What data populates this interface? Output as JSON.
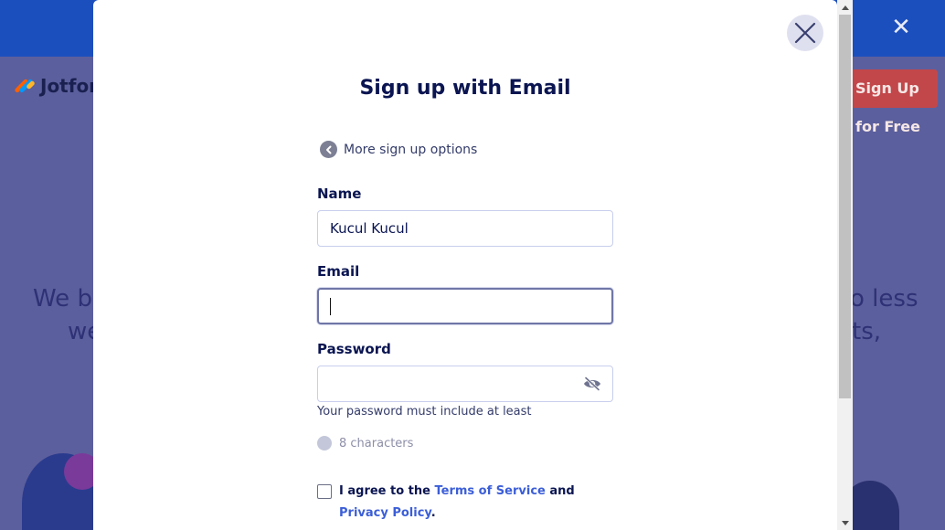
{
  "background": {
    "logo_text": "Jotform",
    "signup_button_label": "Sign Up for Free",
    "headline_left_1": "We b",
    "headline_left_2": "we",
    "headline_right_1": "o less",
    "headline_right_2": "ts,"
  },
  "modal": {
    "title": "Sign up with Email",
    "back_link": "More sign up options",
    "name_label": "Name",
    "name_value": "Kucul Kucul",
    "email_label": "Email",
    "email_value": "",
    "password_label": "Password",
    "password_value": "",
    "password_hint": "Your password must include at least",
    "requirement": "8 characters",
    "agree_prefix": "I agree to the ",
    "terms_link": "Terms of Service",
    "agree_and": " and ",
    "privacy_link": "Privacy Policy",
    "agree_suffix": "."
  },
  "icons": {
    "close": "close-icon",
    "back": "chevron-left-icon",
    "eye": "eye-off-icon"
  },
  "colors": {
    "title": "#0a1551",
    "link": "#3b5ed8",
    "overlay": "#5c5f9d",
    "banner": "#1c4fbe",
    "signup_button": "#c2474a"
  }
}
